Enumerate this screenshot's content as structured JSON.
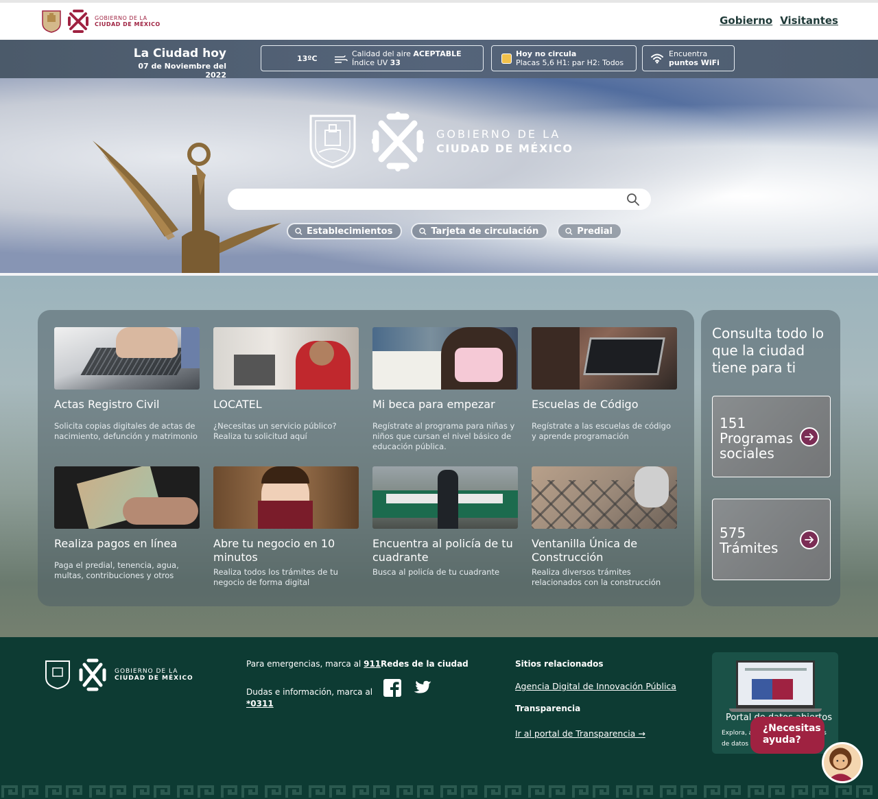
{
  "header": {
    "logo_line1": "GOBIERNO DE LA",
    "logo_line2": "CIUDAD DE MÉXICO",
    "nav": [
      "Gobierno",
      "Visitantes"
    ]
  },
  "info_bar": {
    "title": "La Ciudad hoy",
    "date": "07 de Noviembre del 2022",
    "temperature": "13ºC",
    "air_quality_label": "Calidad del aire",
    "air_quality_value": "ACEPTABLE",
    "uv_label": "Índice UV",
    "uv_value": "33",
    "no_circula_title": "Hoy no circula",
    "no_circula_detail": "Placas 5,6 H1: par H2: Todos",
    "wifi_line1": "Encuentra",
    "wifi_line2": "puntos WiFi"
  },
  "hero": {
    "logo_line1": "GOBIERNO DE LA",
    "logo_line2": "CIUDAD DE MÉXICO",
    "search_value": "",
    "chips": [
      "Establecimientos",
      "Tarjeta de circulación",
      "Predial"
    ]
  },
  "cards": [
    {
      "title": "Actas Registro Civil",
      "desc": "Solicita copias digitales de actas de nacimiento, defunción y matrimonio"
    },
    {
      "title": "LOCATEL",
      "desc": "¿Necesitas un servicio público? Realiza tu solicitud aquí"
    },
    {
      "title": "Mi beca para empezar",
      "desc": "Regístrate al programa para niñas y niños que cursan el nivel básico de educación pública."
    },
    {
      "title": "Escuelas de Código",
      "desc": "Regístrate a las escuelas de código y aprende programación"
    },
    {
      "title": "Realiza pagos en línea",
      "desc": "Paga el predial, tenencia, agua, multas, contribuciones y otros"
    },
    {
      "title": "Abre tu negocio en 10 minutos",
      "desc": "Realiza todos los trámites de tu negocio de forma digital"
    },
    {
      "title": "Encuentra al policía de tu cuadrante",
      "desc": "Busca al policía de tu cuadrante"
    },
    {
      "title": "Ventanilla Única de Construcción",
      "desc": "Realiza diversos trámites relacionados con la construcción"
    }
  ],
  "side": {
    "title": "Consulta todo lo que la ciudad tiene para ti",
    "programs_count": "151",
    "programs_label": "Programas sociales",
    "tramites_count": "575",
    "tramites_label": "Trámites"
  },
  "footer": {
    "logo_line1": "GOBIERNO DE LA",
    "logo_line2": "CIUDAD DE MÉXICO",
    "emergency_text": "Para emergencias, marca al",
    "emergency_number": "911",
    "info_text": "Dudas e información, marca al",
    "info_number": "*0311",
    "social_title": "Redes de la ciudad",
    "related_title": "Sitios relacionados",
    "related_link": "Agencia Digital de Innovación Pública",
    "transparency_title": "Transparencia",
    "transparency_link": "Ir al portal de Transparencia →",
    "portal_title": "Portal de datos abiertos",
    "portal_text": "Explora, analiza y descarga bases de datos",
    "help_button": "¿Necesitas ayuda?"
  },
  "colors": {
    "brand_red": "#9f2241",
    "footer_green": "#0d3b33",
    "chip_yellow": "#f2c14b"
  }
}
